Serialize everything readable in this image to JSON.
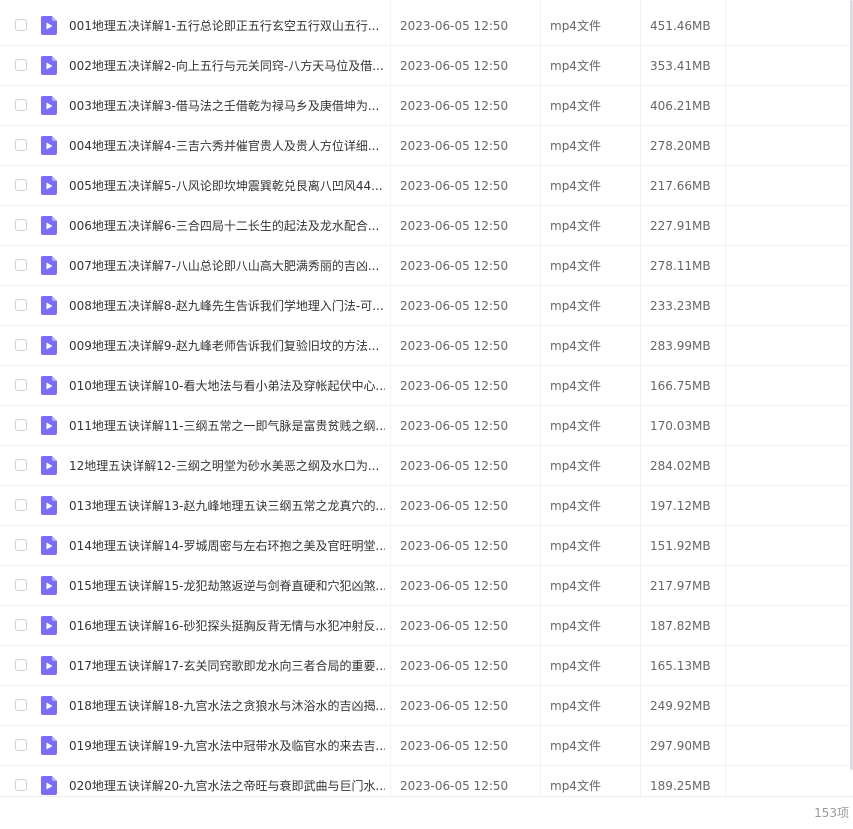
{
  "colors": {
    "file_icon": "#7b6cf6",
    "checkbox_border": "#cfd2d9",
    "row_divider": "#f2f2f4"
  },
  "icons": {
    "row_checkbox": "checkbox-icon",
    "row_file": "video-file-icon"
  },
  "files": [
    {
      "name": "001地理五决详解1-五行总论即正五行玄空五行双山五行...",
      "date": "2023-06-05 12:50",
      "type": "mp4文件",
      "size": "451.46MB"
    },
    {
      "name": "002地理五决详解2-向上五行与元关同窍-八方天马位及借...",
      "date": "2023-06-05 12:50",
      "type": "mp4文件",
      "size": "353.41MB"
    },
    {
      "name": "003地理五决详解3-借马法之壬借乾为禄马乡及庚借坤为...",
      "date": "2023-06-05 12:50",
      "type": "mp4文件",
      "size": "406.21MB"
    },
    {
      "name": "004地理五决详解4-三吉六秀并催官贵人及贵人方位详细...",
      "date": "2023-06-05 12:50",
      "type": "mp4文件",
      "size": "278.20MB"
    },
    {
      "name": "005地理五决详解5-八风论即坎坤震巽乾兑艮离八凹风44...",
      "date": "2023-06-05 12:50",
      "type": "mp4文件",
      "size": "217.66MB"
    },
    {
      "name": "006地理五决详解6-三合四局十二长生的起法及龙水配合...",
      "date": "2023-06-05 12:50",
      "type": "mp4文件",
      "size": "227.91MB"
    },
    {
      "name": "007地理五决详解7-八山总论即八山高大肥满秀丽的吉凶...",
      "date": "2023-06-05 12:50",
      "type": "mp4文件",
      "size": "278.11MB"
    },
    {
      "name": "008地理五决详解8-赵九峰先生告诉我们学地理入门法-可...",
      "date": "2023-06-05 12:50",
      "type": "mp4文件",
      "size": "233.23MB"
    },
    {
      "name": "009地理五决详解9-赵九峰老师告诉我们复验旧坟的方法...",
      "date": "2023-06-05 12:50",
      "type": "mp4文件",
      "size": "283.99MB"
    },
    {
      "name": "010地理五诀详解10-看大地法与看小弟法及穿帐起伏中心...",
      "date": "2023-06-05 12:50",
      "type": "mp4文件",
      "size": "166.75MB"
    },
    {
      "name": "011地理五诀详解11-三纲五常之一即气脉是富贵贫贱之纲...",
      "date": "2023-06-05 12:50",
      "type": "mp4文件",
      "size": "170.03MB"
    },
    {
      "name": "12地理五诀详解12-三纲之明堂为砂水美恶之纲及水口为...",
      "date": "2023-06-05 12:50",
      "type": "mp4文件",
      "size": "284.02MB"
    },
    {
      "name": "013地理五诀详解13-赵九峰地理五诀三纲五常之龙真穴的...",
      "date": "2023-06-05 12:50",
      "type": "mp4文件",
      "size": "197.12MB"
    },
    {
      "name": "014地理五诀详解14-罗城周密与左右环抱之美及官旺明堂...",
      "date": "2023-06-05 12:50",
      "type": "mp4文件",
      "size": "151.92MB"
    },
    {
      "name": "015地理五诀详解15-龙犯劫煞返逆与剑脊直硬和穴犯凶煞...",
      "date": "2023-06-05 12:50",
      "type": "mp4文件",
      "size": "217.97MB"
    },
    {
      "name": "016地理五诀详解16-砂犯探头挺胸反背无情与水犯冲射反...",
      "date": "2023-06-05 12:50",
      "type": "mp4文件",
      "size": "187.82MB"
    },
    {
      "name": "017地理五诀详解17-玄关同窍歌即龙水向三者合局的重要...",
      "date": "2023-06-05 12:50",
      "type": "mp4文件",
      "size": "165.13MB"
    },
    {
      "name": "018地理五诀详解18-九宫水法之贪狼水与沐浴水的吉凶揭...",
      "date": "2023-06-05 12:50",
      "type": "mp4文件",
      "size": "249.92MB"
    },
    {
      "name": "019地理五诀详解19-九宫水法中冠带水及临官水的来去吉...",
      "date": "2023-06-05 12:50",
      "type": "mp4文件",
      "size": "297.90MB"
    },
    {
      "name": "020地理五诀详解20-九宫水法之帝旺与衰即武曲与巨门水...",
      "date": "2023-06-05 12:50",
      "type": "mp4文件",
      "size": "189.25MB"
    }
  ],
  "footer": {
    "item_count": "153项"
  }
}
